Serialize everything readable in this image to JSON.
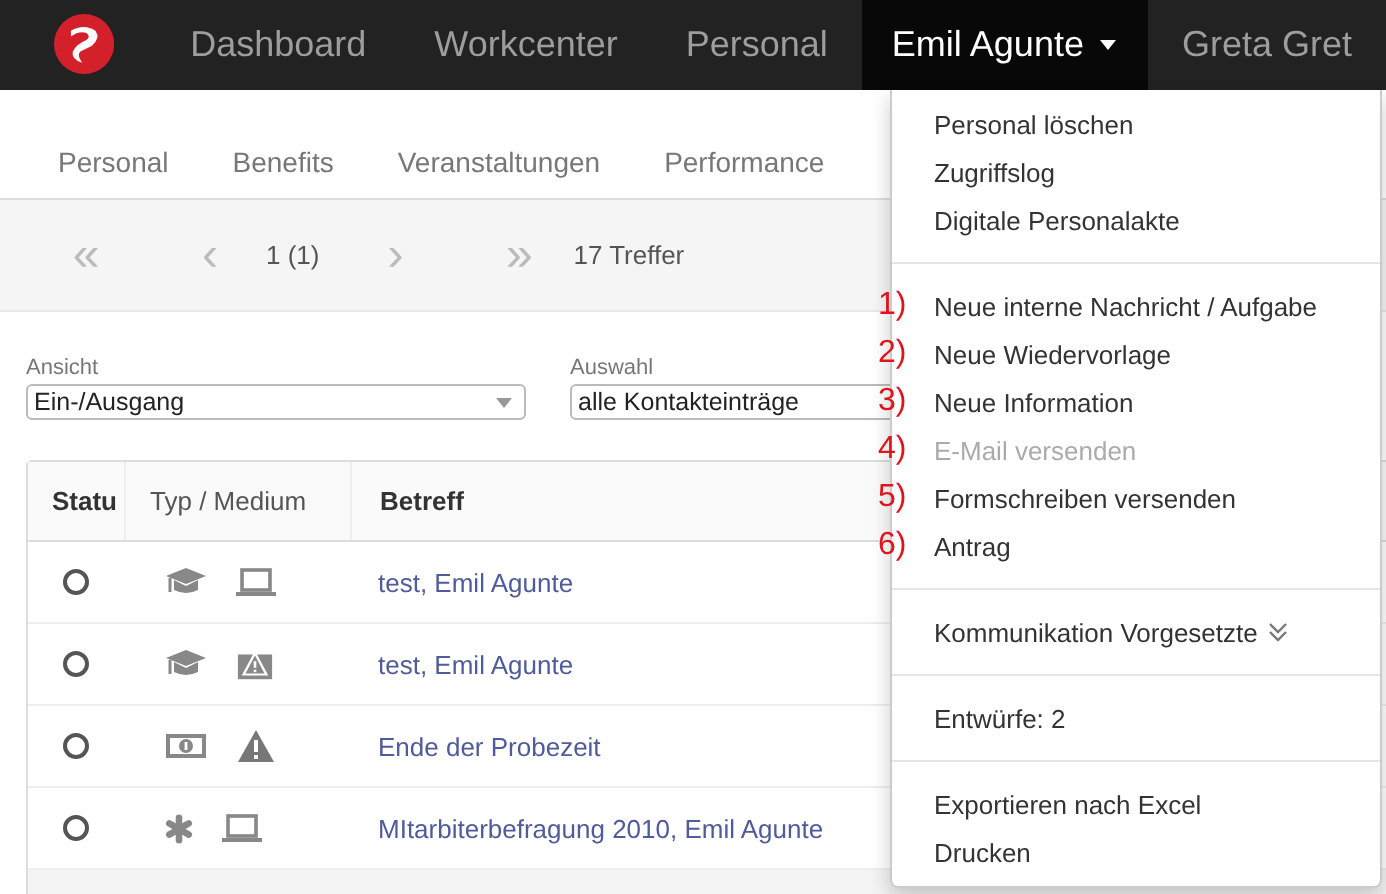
{
  "navbar": {
    "items": [
      {
        "label": "Dashboard",
        "selected": false,
        "dropdown": false
      },
      {
        "label": "Workcenter",
        "selected": false,
        "dropdown": false
      },
      {
        "label": "Personal",
        "selected": false,
        "dropdown": false
      },
      {
        "label": "Emil Agunte",
        "selected": true,
        "dropdown": true
      },
      {
        "label": "Greta Gret",
        "selected": false,
        "dropdown": false
      }
    ]
  },
  "subnav": {
    "tabs": [
      {
        "label": "Personal"
      },
      {
        "label": "Benefits"
      },
      {
        "label": "Veranstaltungen"
      },
      {
        "label": "Performance"
      }
    ]
  },
  "pager": {
    "first": "«",
    "prev": "‹",
    "page": "1 (1)",
    "next": "›",
    "last": "»",
    "count": "17 Treffer"
  },
  "filters": [
    {
      "label": "Ansicht",
      "value": "Ein-/Ausgang"
    },
    {
      "label": "Auswahl",
      "value": "alle Kontakteinträge"
    }
  ],
  "table": {
    "columns": [
      "Statu",
      "Typ / Medium",
      "Betreff"
    ],
    "rows": [
      {
        "icons": [
          {
            "kind": "graduation"
          },
          {
            "kind": "laptop"
          }
        ],
        "subject": "test, Emil Agunte"
      },
      {
        "icons": [
          {
            "kind": "graduation"
          },
          {
            "kind": "alert"
          }
        ],
        "subject": "test, Emil Agunte"
      },
      {
        "icons": [
          {
            "kind": "money"
          },
          {
            "kind": "warning"
          }
        ],
        "subject": "Ende der Probezeit"
      },
      {
        "icons": [
          {
            "kind": "asterisk"
          },
          {
            "kind": "laptop"
          }
        ],
        "subject": "MItarbiterbefragung 2010, Emil Agunte"
      }
    ]
  },
  "menu": {
    "sections": [
      {
        "items": [
          {
            "label": "Personal löschen",
            "disabled": false
          },
          {
            "label": "Zugriffslog",
            "disabled": false
          },
          {
            "label": "Digitale Personalakte",
            "disabled": false
          }
        ]
      },
      {
        "items": [
          {
            "label": "Neue interne Nachricht / Aufgabe",
            "disabled": false,
            "marker": "1)"
          },
          {
            "label": "Neue Wiedervorlage",
            "disabled": false,
            "marker": "2)"
          },
          {
            "label": "Neue Information",
            "disabled": false,
            "marker": "3)"
          },
          {
            "label": "E-Mail versenden",
            "disabled": true,
            "marker": "4)"
          },
          {
            "label": "Formschreiben versenden",
            "disabled": false,
            "marker": "5)"
          },
          {
            "label": "Antrag",
            "disabled": false,
            "marker": "6)"
          }
        ]
      },
      {
        "items": [
          {
            "label": "Kommunikation Vorgesetzte",
            "disabled": false,
            "collapsed": true
          }
        ]
      },
      {
        "items": [
          {
            "label": "Entwürfe: 2",
            "disabled": false
          }
        ]
      },
      {
        "items": [
          {
            "label": "Exportieren nach Excel",
            "disabled": false
          },
          {
            "label": "Drucken",
            "disabled": false
          }
        ]
      }
    ]
  }
}
